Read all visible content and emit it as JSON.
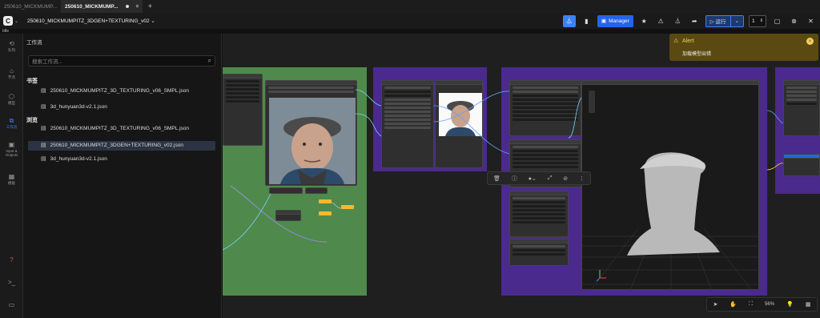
{
  "browser": {
    "tabs": [
      {
        "label": "250610_MICKMUMP..."
      },
      {
        "label": "250610_MICKMUMP..."
      }
    ],
    "new_tab": "+"
  },
  "topbar": {
    "logo_letter": "C",
    "workflow_name": "250610_MICKMUMPITZ_3DGEN+TEXTURING_v02 ⌄",
    "manager_label": "Manager",
    "run_label": "▷ 运行",
    "run_count": "1"
  },
  "sublabel": "Idle",
  "rail": {
    "items": [
      {
        "icon": "⟲",
        "label": "队列"
      },
      {
        "icon": "⌂",
        "label": "节点"
      },
      {
        "icon": "⬡",
        "label": "模型"
      },
      {
        "icon": "⧉",
        "label": "工作流"
      },
      {
        "icon": "▣",
        "label": "Input & Outputs"
      },
      {
        "icon": "▦",
        "label": "模板"
      }
    ],
    "bottom": [
      {
        "icon": "?",
        "label": ""
      },
      {
        "icon": ">_",
        "label": ""
      },
      {
        "icon": "▭",
        "label": ""
      }
    ]
  },
  "workflow_panel": {
    "title": "工作流",
    "search_placeholder": "搜索工作流...",
    "bookmarks_heading": "书签",
    "bookmarks": [
      "250610_MICKMUMPITZ_3D_TEXTURING_v06_SMPL.json",
      "3d_hunyuan3d-v2.1.json"
    ],
    "browse_heading": "浏览",
    "browse": [
      "250610_MICKMUMPITZ_3D_TEXTURING_v06_SMPL.json",
      "250610_MICKMUMPITZ_3DGEN+TEXTURING_v02.json",
      "3d_hunyuan3d-v2.1.json"
    ]
  },
  "alert": {
    "title": "Alert",
    "message": "加载模型出错"
  },
  "canvas_controls": {
    "zoom": "56%"
  },
  "colors": {
    "accent": "#3b82f6",
    "group_green": "#4f8a4c",
    "group_purple": "#4a2a8c",
    "alert_bg": "#5a4a12"
  }
}
